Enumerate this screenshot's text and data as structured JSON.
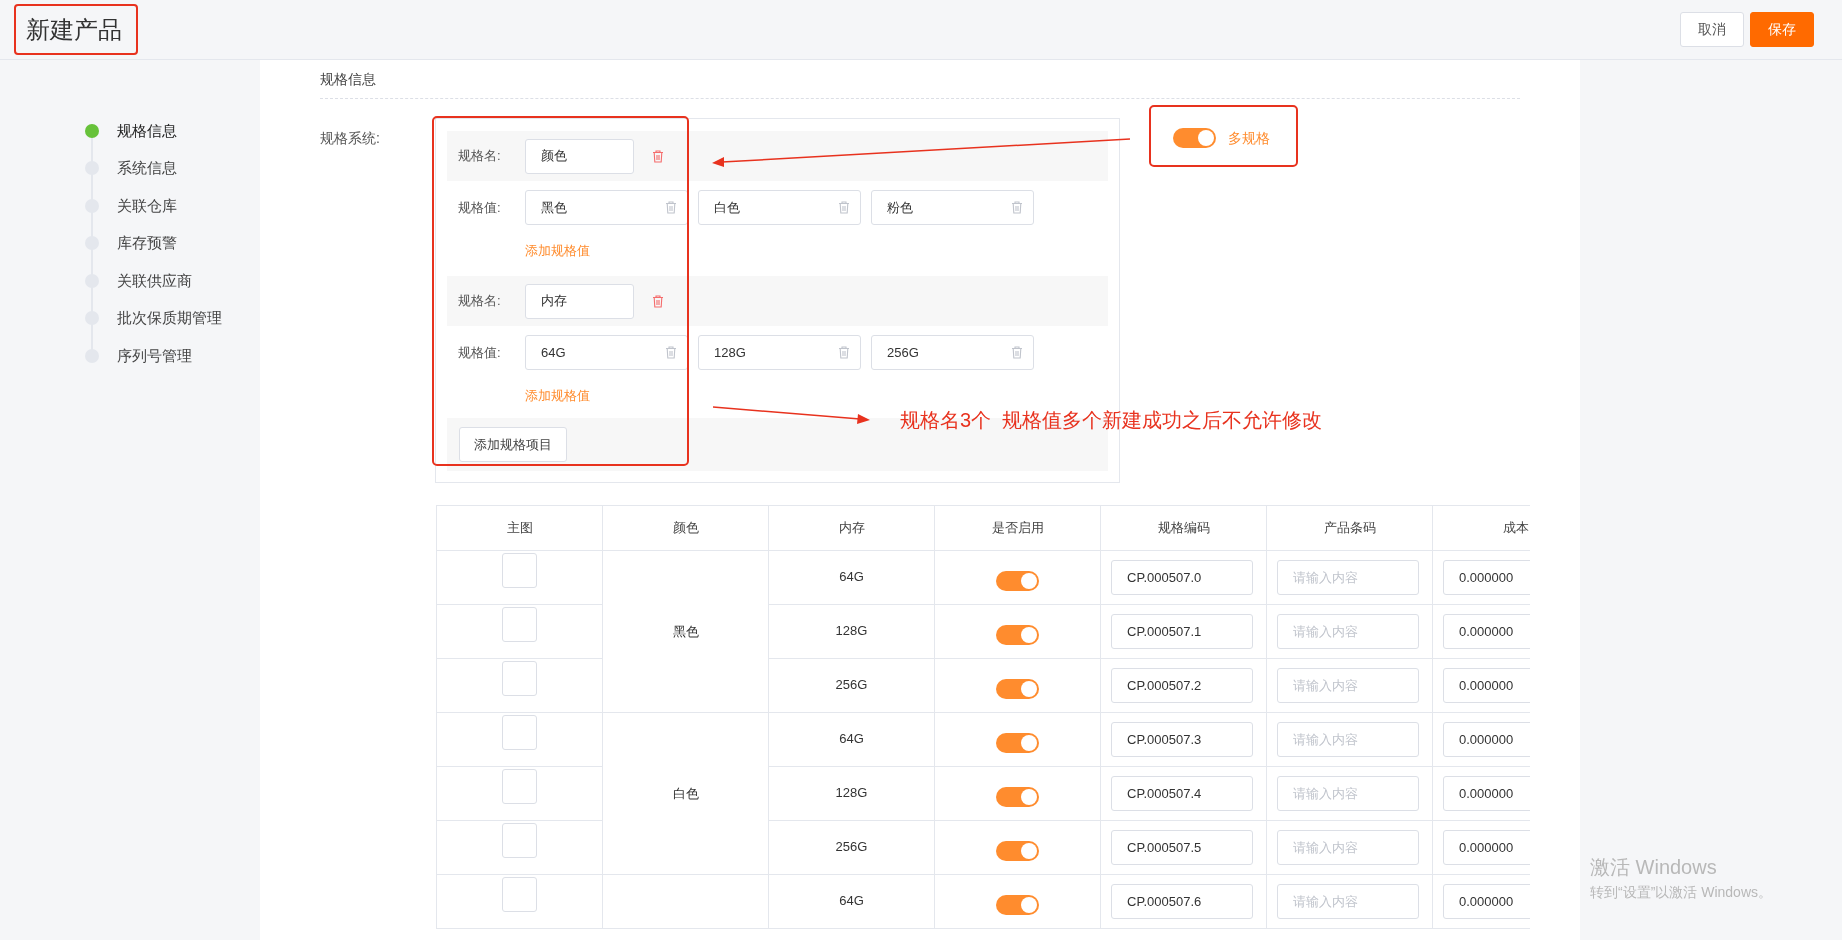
{
  "header": {
    "title": "新建产品",
    "buttons": [
      {
        "label": "取消",
        "kind": "default"
      },
      {
        "label": "保存",
        "kind": "primary"
      }
    ]
  },
  "steps": [
    {
      "label": "规格信息",
      "selected": true
    },
    {
      "label": "系统信息",
      "selected": false
    },
    {
      "label": "关联仓库",
      "selected": false
    },
    {
      "label": "库存预警",
      "selected": false
    },
    {
      "label": "关联供应商",
      "selected": false
    },
    {
      "label": "批次保质期管理",
      "selected": false
    },
    {
      "label": "序列号管理",
      "selected": false
    }
  ],
  "section_title": "规格信息",
  "spec_system": {
    "label": "规格系统:",
    "groups": [
      {
        "name_label": "规格名:",
        "name": "颜色",
        "value_label": "规格值:",
        "values": [
          "黑色",
          "白色",
          "粉色"
        ],
        "add_value_link": "添加规格值"
      },
      {
        "name_label": "规格名:",
        "name": "内存",
        "value_label": "规格值:",
        "values": [
          "64G",
          "128G",
          "256G"
        ],
        "add_value_link": "添加规格值"
      }
    ],
    "add_item_button": "添加规格项目"
  },
  "multi_spec_toggle": {
    "label": "多规格",
    "on": true
  },
  "annotation": {
    "text": "规格名3个  规格值多个新建成功之后不允许修改"
  },
  "table": {
    "columns": [
      "主图",
      "颜色",
      "内存",
      "是否启用",
      "规格编码",
      "产品条码",
      "成本"
    ],
    "groups": [
      {
        "label": "黑色",
        "rows": [
          {
            "memory": "64G",
            "enabled": true,
            "spec_code": "CP.000507.0",
            "barcode_placeholder": "请输入内容",
            "cost": "0.000000"
          },
          {
            "memory": "128G",
            "enabled": true,
            "spec_code": "CP.000507.1",
            "barcode_placeholder": "请输入内容",
            "cost": "0.000000"
          },
          {
            "memory": "256G",
            "enabled": true,
            "spec_code": "CP.000507.2",
            "barcode_placeholder": "请输入内容",
            "cost": "0.000000"
          }
        ]
      },
      {
        "label": "白色",
        "rows": [
          {
            "memory": "64G",
            "enabled": true,
            "spec_code": "CP.000507.3",
            "barcode_placeholder": "请输入内容",
            "cost": "0.000000"
          },
          {
            "memory": "128G",
            "enabled": true,
            "spec_code": "CP.000507.4",
            "barcode_placeholder": "请输入内容",
            "cost": "0.000000"
          },
          {
            "memory": "256G",
            "enabled": true,
            "spec_code": "CP.000507.5",
            "barcode_placeholder": "请输入内容",
            "cost": "0.000000"
          }
        ]
      },
      {
        "rows": [
          {
            "memory": "64G",
            "enabled": true,
            "spec_code": "CP.000507.6",
            "barcode_placeholder": "请输入内容",
            "cost": "0.000000"
          }
        ]
      }
    ]
  },
  "windows_activation_notice": {
    "title": "激活 Windows",
    "text": "转到“设置”以激活 Windows。"
  }
}
